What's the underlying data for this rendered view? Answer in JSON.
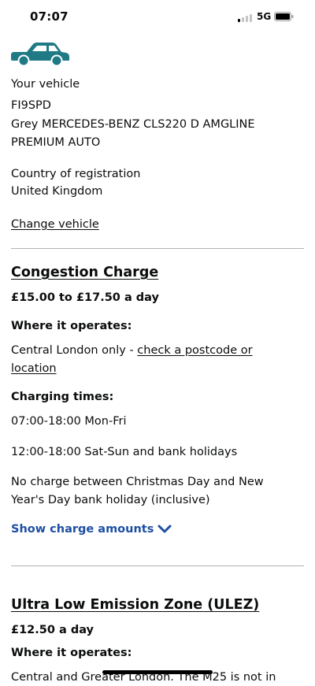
{
  "status": {
    "time": "07:07",
    "network": "5G"
  },
  "vehicle": {
    "heading": "Your vehicle",
    "reg": "FI9SPD",
    "desc_line1": "Grey MERCEDES-BENZ CLS220 D AMGLINE",
    "desc_line2": "PREMIUM AUTO",
    "country_heading": "Country of registration",
    "country": "United Kingdom",
    "change_link": "Change vehicle"
  },
  "congestion": {
    "title": "Congestion Charge",
    "price": "£15.00 to £17.50 a day",
    "where_heading": "Where it operates:",
    "where_text": "Central London only - ",
    "postcode_link_line1": "check a postcode or",
    "postcode_link_line2": "location",
    "times_heading": "Charging times:",
    "time1": "07:00-18:00 Mon-Fri",
    "time2": "12:00-18:00 Sat-Sun and bank holidays",
    "note_line1": "No charge between Christmas Day and New",
    "note_line2": "Year's Day bank holiday (inclusive)",
    "show_amounts": "Show charge amounts"
  },
  "ulez": {
    "title": "Ultra Low Emission Zone (ULEZ)",
    "price": "£12.50 a day",
    "where_heading": "Where it operates:",
    "where_text": "Central and Greater London. The M25 is not in"
  },
  "colors": {
    "car": "#1f7a86",
    "link": "#1d4fa3",
    "divider": "#b1b4b6"
  }
}
